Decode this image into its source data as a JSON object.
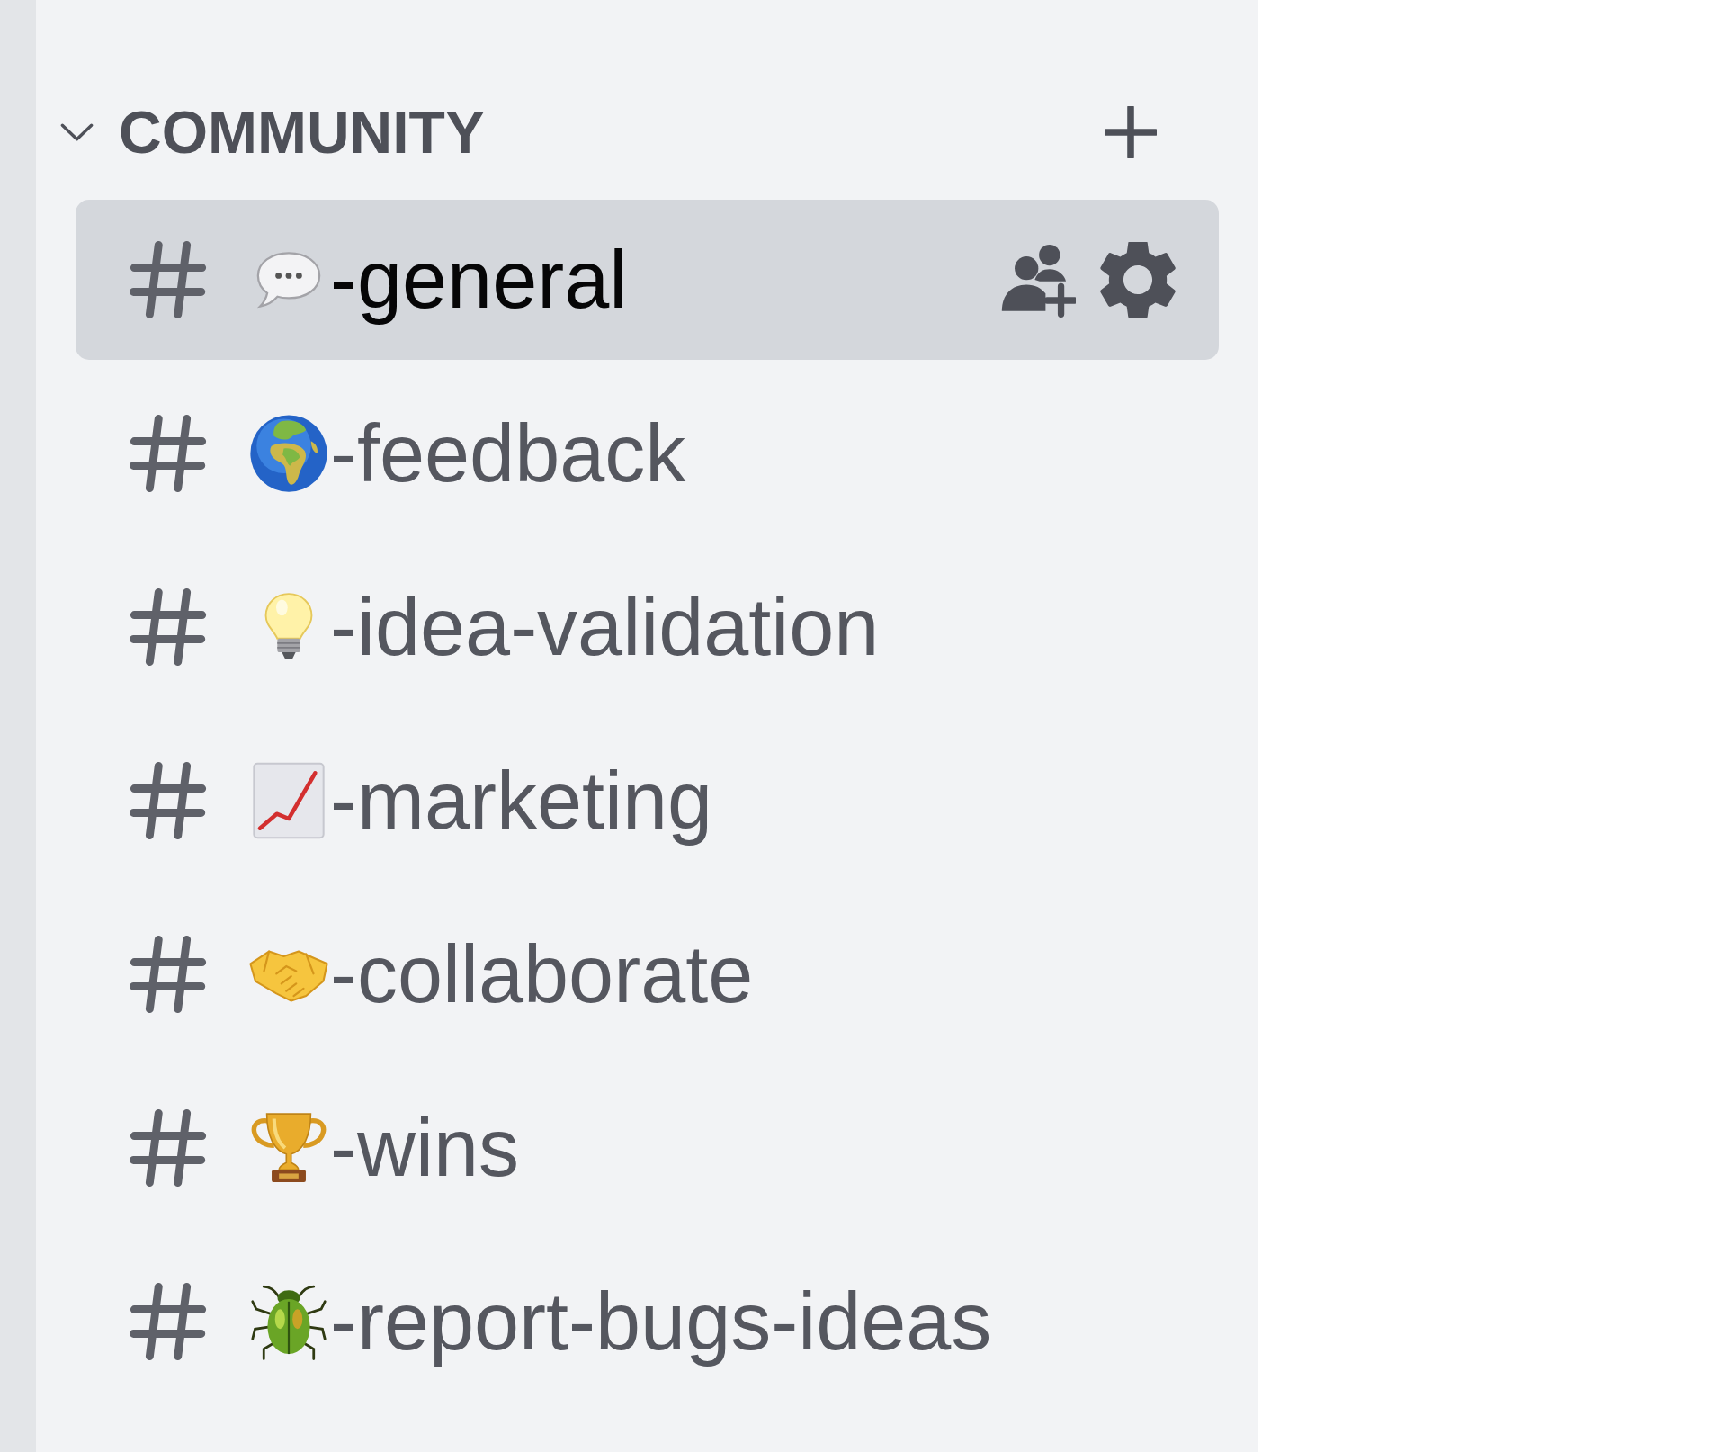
{
  "category": {
    "label": "COMMUNITY",
    "expanded": true
  },
  "channels": [
    {
      "name": "-general",
      "kind": "speech",
      "selected": true
    },
    {
      "name": "-feedback",
      "kind": "globe",
      "selected": false
    },
    {
      "name": "-idea-validation",
      "kind": "bulb",
      "selected": false
    },
    {
      "name": "-marketing",
      "kind": "chart",
      "selected": false
    },
    {
      "name": "-collaborate",
      "kind": "handshake",
      "selected": false
    },
    {
      "name": "-wins",
      "kind": "trophy",
      "selected": false
    },
    {
      "name": "-report-bugs-ideas",
      "kind": "beetle",
      "selected": false
    }
  ]
}
